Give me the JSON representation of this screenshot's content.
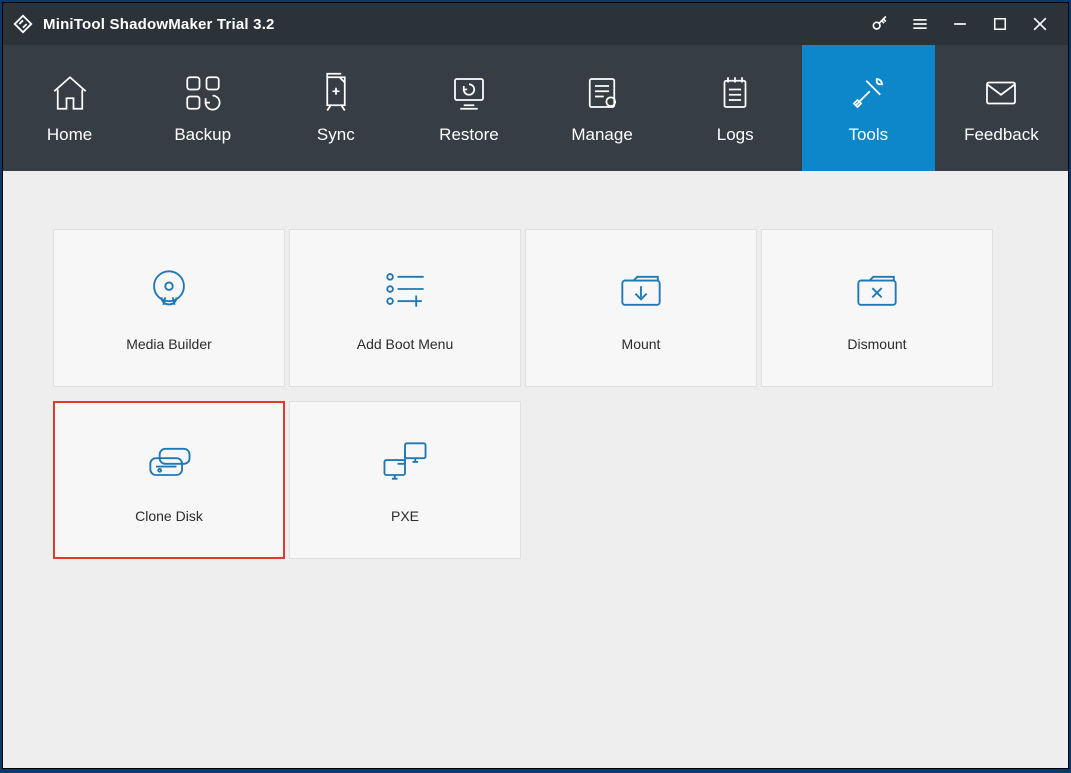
{
  "app": {
    "title": "MiniTool ShadowMaker Trial 3.2"
  },
  "nav": {
    "items": [
      {
        "label": "Home"
      },
      {
        "label": "Backup"
      },
      {
        "label": "Sync"
      },
      {
        "label": "Restore"
      },
      {
        "label": "Manage"
      },
      {
        "label": "Logs"
      },
      {
        "label": "Tools"
      },
      {
        "label": "Feedback"
      }
    ],
    "active_index": 6
  },
  "tools": {
    "items": [
      {
        "label": "Media Builder"
      },
      {
        "label": "Add Boot Menu"
      },
      {
        "label": "Mount"
      },
      {
        "label": "Dismount"
      },
      {
        "label": "Clone Disk"
      },
      {
        "label": "PXE"
      }
    ],
    "highlighted_index": 4
  }
}
